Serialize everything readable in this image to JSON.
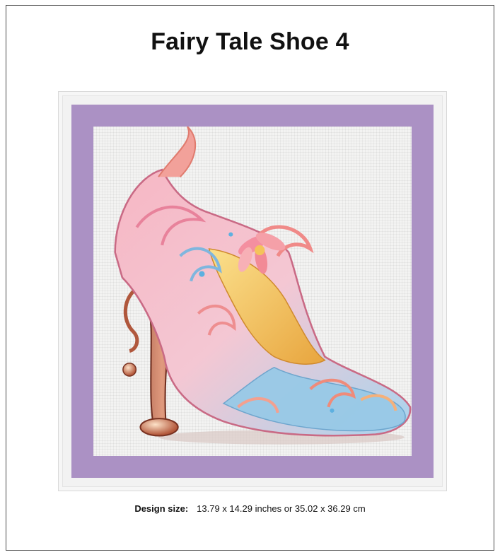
{
  "title": "Fairy Tale Shoe 4",
  "design_size": {
    "label": "Design size:",
    "value": "13.79 x 14.29 inches or 35.02 x 36.29 cm"
  },
  "colors": {
    "mat": "#ab91c4",
    "fabric": "#f3f3f2",
    "shoe_pink": "#f2a3b4",
    "shoe_blue": "#9ccbe8",
    "shoe_gold": "#f4c35a",
    "heel_copper": "#b86a4e"
  }
}
